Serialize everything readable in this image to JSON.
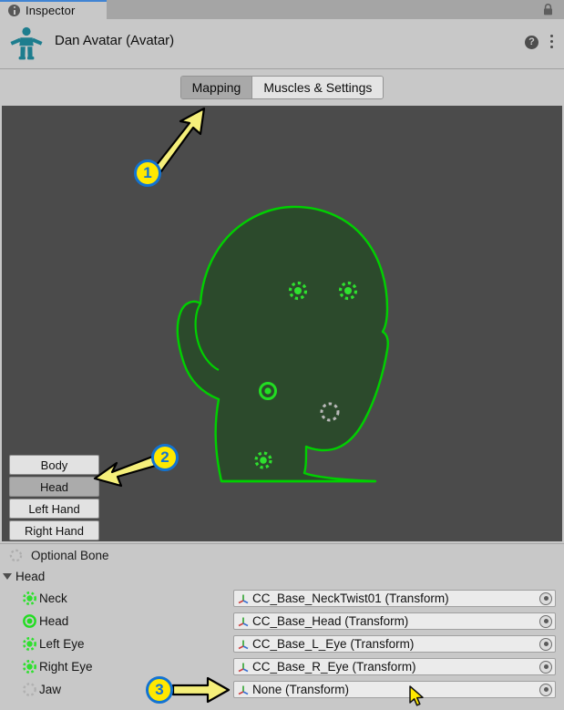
{
  "window": {
    "tab_label": "Inspector",
    "tab_icon": "info-icon",
    "lock_icon": "lock-icon"
  },
  "object_header": {
    "icon": "avatar-icon",
    "title": "Dan Avatar (Avatar)",
    "help_icon": "help-icon",
    "menu_icon": "kebab-menu-icon"
  },
  "toolbar": {
    "tabs": [
      {
        "label": "Mapping",
        "active": true
      },
      {
        "label": "Muscles & Settings",
        "active": false
      }
    ]
  },
  "viewport": {
    "background_color": "#4b4b4b",
    "silhouette_outline_color": "#00d000",
    "silhouette_fill_color": "#2c4a2c",
    "part_buttons": [
      {
        "label": "Body",
        "active": false
      },
      {
        "label": "Head",
        "active": true
      },
      {
        "label": "Left Hand",
        "active": false
      },
      {
        "label": "Right Hand",
        "active": false
      }
    ],
    "bone_markers": [
      {
        "name": "left-eye-marker",
        "state": "optional-assigned",
        "color": "#2ee02e"
      },
      {
        "name": "right-eye-marker",
        "state": "optional-assigned",
        "color": "#2ee02e"
      },
      {
        "name": "head-marker",
        "state": "required-assigned",
        "color": "#22dd22"
      },
      {
        "name": "jaw-marker",
        "state": "optional-unassigned",
        "color": "#b9b9b9"
      },
      {
        "name": "neck-marker",
        "state": "optional-assigned",
        "color": "#2ee02e"
      }
    ]
  },
  "bone_panel": {
    "legend": {
      "label": "Optional Bone",
      "icon": "dotted-circle-icon"
    },
    "group": {
      "label": "Head",
      "expanded": true
    },
    "rows": [
      {
        "name": "Neck",
        "marker": "optional-assigned",
        "value": "CC_Base_NeckTwist01 (Transform)"
      },
      {
        "name": "Head",
        "marker": "required-assigned",
        "value": "CC_Base_Head (Transform)"
      },
      {
        "name": "Left Eye",
        "marker": "optional-assigned",
        "value": "CC_Base_L_Eye (Transform)"
      },
      {
        "name": "Right Eye",
        "marker": "optional-assigned",
        "value": "CC_Base_R_Eye (Transform)"
      },
      {
        "name": "Jaw",
        "marker": "optional-unassigned",
        "value": "None (Transform)"
      }
    ],
    "field_icon": "transform-gizmo-icon",
    "picker_icon": "object-picker-icon"
  },
  "annotations": [
    {
      "id": "1",
      "label": "1",
      "target": "mapping-tab"
    },
    {
      "id": "2",
      "label": "2",
      "target": "head-part-button"
    },
    {
      "id": "3",
      "label": "3",
      "target": "jaw-object-field"
    }
  ],
  "cursor": {
    "icon": "mouse-pointer-icon",
    "color": "#ffe800"
  }
}
